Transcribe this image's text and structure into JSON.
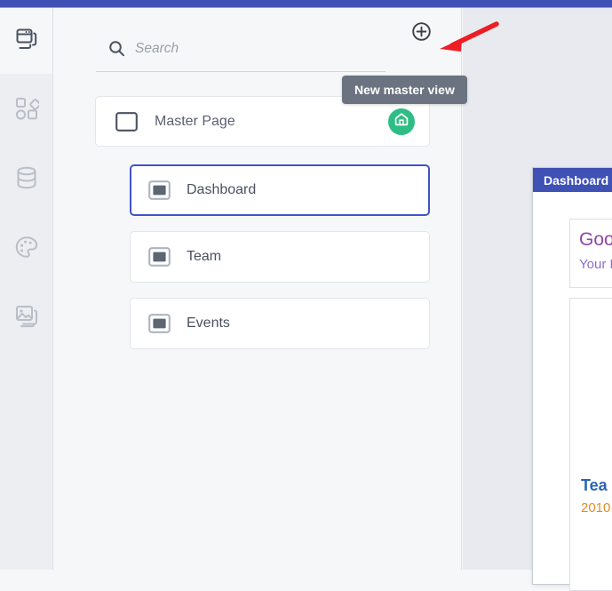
{
  "window": {
    "app_icon": "windows-stack-icon",
    "accent_color": "#3f51b5"
  },
  "rail": {
    "items": [
      {
        "name": "components",
        "icon": "shapes-icon"
      },
      {
        "name": "data",
        "icon": "database-icon"
      },
      {
        "name": "styles",
        "icon": "palette-icon"
      },
      {
        "name": "media",
        "icon": "images-icon"
      }
    ]
  },
  "search": {
    "placeholder": "Search",
    "value": "",
    "icon": "search-icon"
  },
  "toolbar": {
    "add_button_icon": "plus-circle-icon",
    "tooltip": "New master view"
  },
  "master_list": {
    "master": {
      "label": "Master Page",
      "icon": "page-outline-icon",
      "badge_icon": "home-icon",
      "badge_color": "#2ebd85"
    },
    "children": [
      {
        "label": "Dashboard",
        "icon": "view-icon",
        "selected": true
      },
      {
        "label": "Team",
        "icon": "view-icon",
        "selected": false
      },
      {
        "label": "Events",
        "icon": "view-icon",
        "selected": false
      }
    ],
    "selection_color": "#4054c8"
  },
  "canvas": {
    "artboard_title": "Dashboard",
    "greeting_title": "Good",
    "greeting_subtitle": "Your H",
    "stat_title": "Tea",
    "stat_value": "2010"
  },
  "annotation": {
    "arrow_color": "#ee1c24",
    "arrow_direction": "left"
  }
}
